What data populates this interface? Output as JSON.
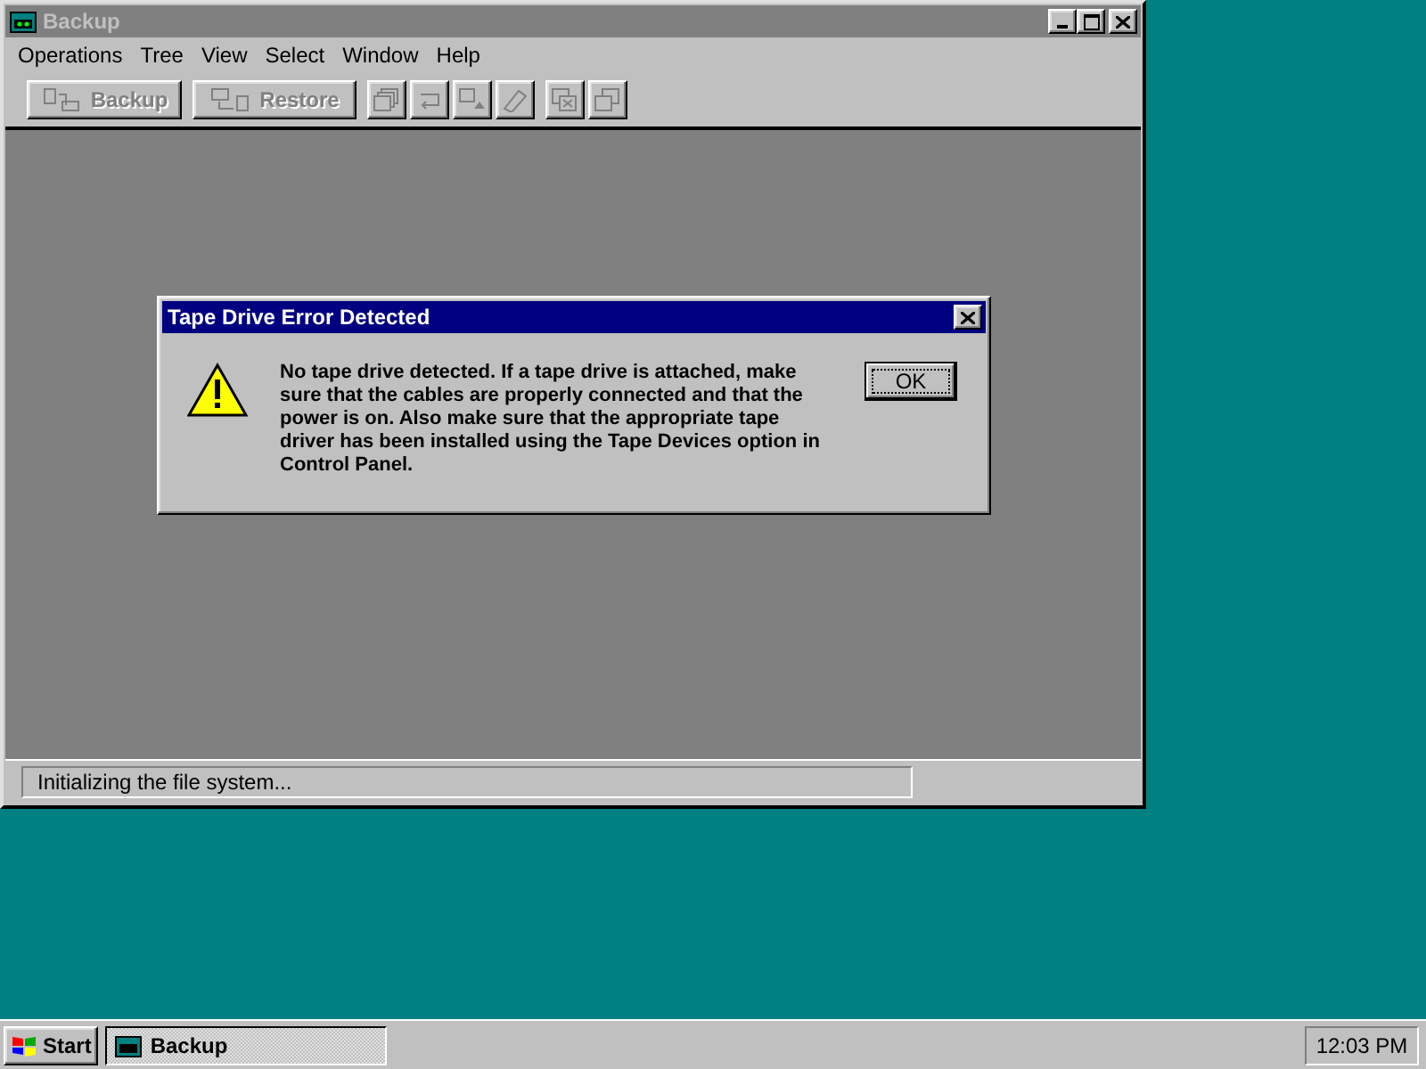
{
  "window": {
    "title": "Backup",
    "active": false
  },
  "menu": [
    {
      "label": "Operations"
    },
    {
      "label": "Tree"
    },
    {
      "label": "View"
    },
    {
      "label": "Select"
    },
    {
      "label": "Window"
    },
    {
      "label": "Help"
    }
  ],
  "toolbar": [
    [
      {
        "kind": "backup",
        "label": "Backup",
        "disabled": true
      },
      {
        "kind": "restore",
        "label": "Restore",
        "disabled": true
      }
    ],
    [
      {
        "kind": "catalog",
        "disabled": true
      },
      {
        "kind": "retension",
        "disabled": true
      },
      {
        "kind": "eject",
        "disabled": true
      },
      {
        "kind": "erase",
        "disabled": true
      }
    ],
    [
      {
        "kind": "tile",
        "disabled": true
      },
      {
        "kind": "cascade",
        "disabled": true
      }
    ]
  ],
  "dialog": {
    "title": "Tape Drive Error Detected",
    "message": "No tape drive detected. If a tape drive is attached, make sure that the cables are properly connected and that the power is on. Also make sure that the appropriate tape driver has been installed using the Tape Devices option in Control Panel.",
    "button": "OK"
  },
  "status_bar": {
    "text": "Initializing the file system..."
  },
  "taskbar": {
    "start": "Start",
    "tasks": [
      {
        "label": "Backup",
        "selected": true
      }
    ],
    "clock": "12:03 PM"
  }
}
